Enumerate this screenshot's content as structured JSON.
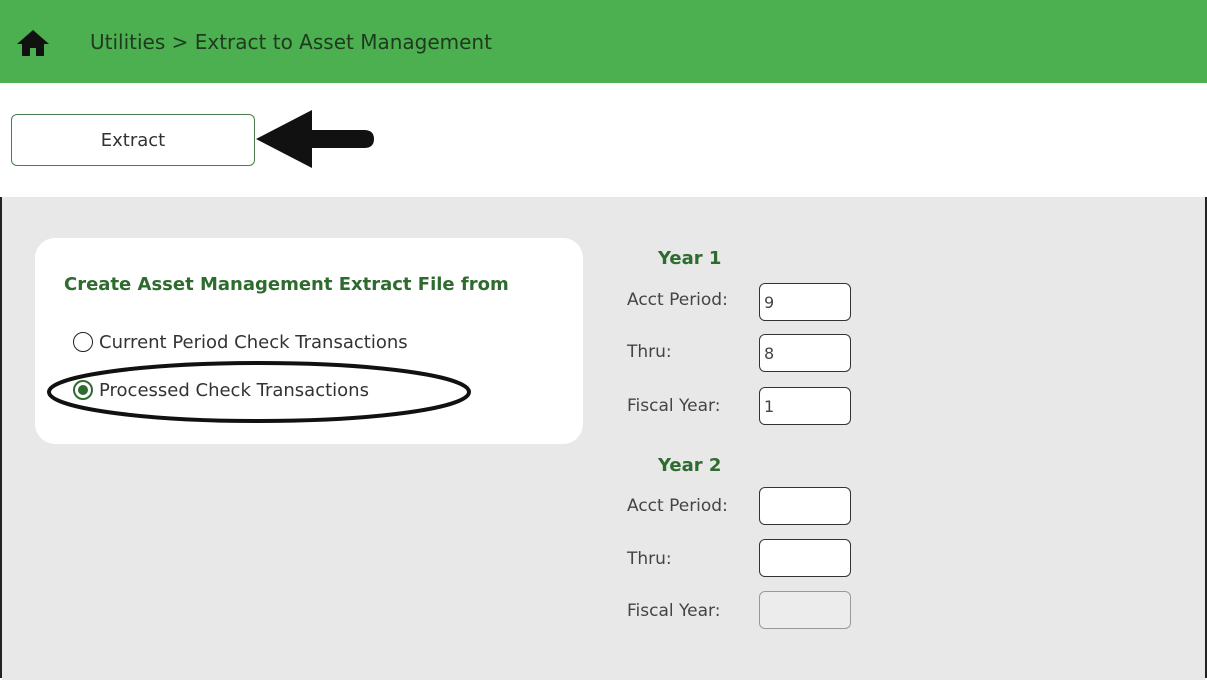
{
  "header": {
    "breadcrumb": "Utilities > Extract to Asset Management",
    "home_icon": "home-icon",
    "color": "#4caf50"
  },
  "toolbar": {
    "extract_label": "Extract"
  },
  "source": {
    "title": "Create Asset Management Extract File from",
    "options": [
      {
        "label": "Current Period Check Transactions",
        "checked": false
      },
      {
        "label": "Processed Check Transactions",
        "checked": true
      }
    ]
  },
  "year1": {
    "heading": "Year 1",
    "acct_period_label": "Acct Period:",
    "acct_period_value": "9",
    "thru_label": "Thru:",
    "thru_value": "8",
    "fiscal_year_label": "Fiscal Year:",
    "fiscal_year_value": "1"
  },
  "year2": {
    "heading": "Year 2",
    "acct_period_label": "Acct Period:",
    "acct_period_value": "",
    "thru_label": "Thru:",
    "thru_value": "",
    "fiscal_year_label": "Fiscal Year:",
    "fiscal_year_value": ""
  },
  "colors": {
    "accent_green": "#2e6b2e",
    "panel_gray": "#e8e8e8"
  }
}
